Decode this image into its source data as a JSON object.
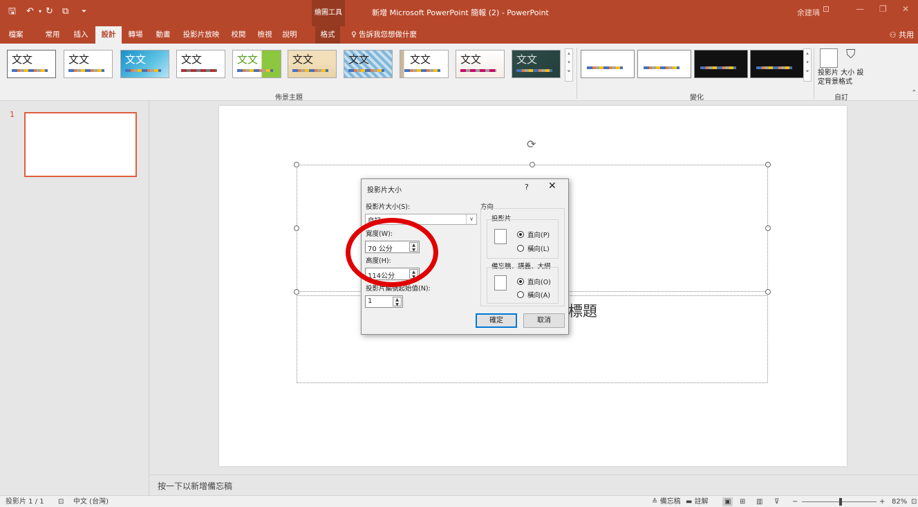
{
  "titlebar": {
    "drawing_tools": "繪圖工具",
    "title": "新增 Microsoft PowerPoint 簡報 (2) - PowerPoint",
    "user": "余建瑀"
  },
  "tabs": [
    "檔案",
    "常用",
    "插入",
    "設計",
    "轉場",
    "動畫",
    "投影片放映",
    "校閱",
    "檢視",
    "說明",
    "格式"
  ],
  "tell_me": "告訴我您想做什麼",
  "share": "共用",
  "ribbon": {
    "theme_text": "文文",
    "group_themes": "佈景主題",
    "group_variants": "變化",
    "group_customize": "自訂",
    "slide_size_label": "投影片 大小",
    "format_bg_label": "設定背景格式"
  },
  "thumbnail": {
    "number": "1"
  },
  "slide": {
    "subtitle_fragment": "標題"
  },
  "notes_placeholder": "按一下以新增備忘稿",
  "status": {
    "slide_info": "投影片 1 / 1",
    "language": "中文 (台灣)",
    "notes": "備忘稿",
    "comments": "註解",
    "zoom": "82%"
  },
  "dialog": {
    "title": "投影片大小",
    "help": "?",
    "close": "✕",
    "size_label": "投影片大小(S):",
    "size_value": "自訂",
    "width_label": "寬度(W):",
    "width_value": "70 公分",
    "height_label": "高度(H):",
    "height_value": "114公分",
    "start_label": "投影片編號起始值(N):",
    "start_value": "1",
    "orientation_label": "方向",
    "slides_label": "投影片",
    "portrait": "直向(P)",
    "landscape": "橫向(L)",
    "notes_label": "備忘稿、講義、大綱",
    "notes_portrait": "直向(O)",
    "notes_landscape": "橫向(A)",
    "ok": "確定",
    "cancel": "取消"
  },
  "colors": {
    "accent": "#b7472a",
    "annotation": "#e00000"
  }
}
